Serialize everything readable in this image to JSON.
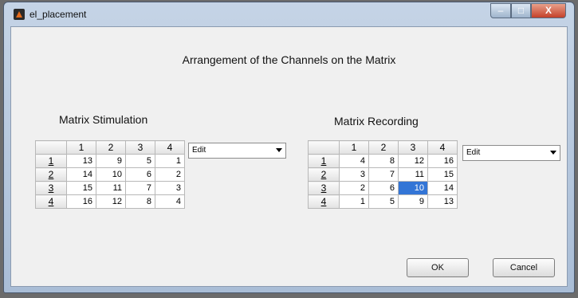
{
  "window": {
    "title": "el_placement",
    "minimize_glyph": "–",
    "maximize_glyph": "□",
    "close_glyph": "X"
  },
  "heading": "Arrangement of the Channels on the Matrix",
  "stimulation": {
    "label": "Matrix Stimulation",
    "col_headers": [
      "1",
      "2",
      "3",
      "4"
    ],
    "rows": [
      {
        "header": "1",
        "cells": [
          "13",
          "9",
          "5",
          "1"
        ]
      },
      {
        "header": "2",
        "cells": [
          "14",
          "10",
          "6",
          "2"
        ]
      },
      {
        "header": "3",
        "cells": [
          "15",
          "11",
          "7",
          "3"
        ]
      },
      {
        "header": "4",
        "cells": [
          "16",
          "12",
          "8",
          "4"
        ]
      }
    ],
    "dropdown_value": "Edit"
  },
  "recording": {
    "label": "Matrix Recording",
    "col_headers": [
      "1",
      "2",
      "3",
      "4"
    ],
    "rows": [
      {
        "header": "1",
        "cells": [
          "4",
          "8",
          "12",
          "16"
        ]
      },
      {
        "header": "2",
        "cells": [
          "3",
          "7",
          "11",
          "15"
        ]
      },
      {
        "header": "3",
        "cells": [
          "2",
          "6",
          "10",
          "14"
        ]
      },
      {
        "header": "4",
        "cells": [
          "1",
          "5",
          "9",
          "13"
        ]
      }
    ],
    "dropdown_value": "Edit",
    "selected_cell": "10"
  },
  "buttons": {
    "ok": "OK",
    "cancel": "Cancel"
  },
  "colors": {
    "selection": "#3375d6",
    "close_button": "#c4412a"
  },
  "icons": [
    "matlab-icon",
    "minimize-icon",
    "maximize-icon",
    "close-icon",
    "chevron-down-icon"
  ]
}
